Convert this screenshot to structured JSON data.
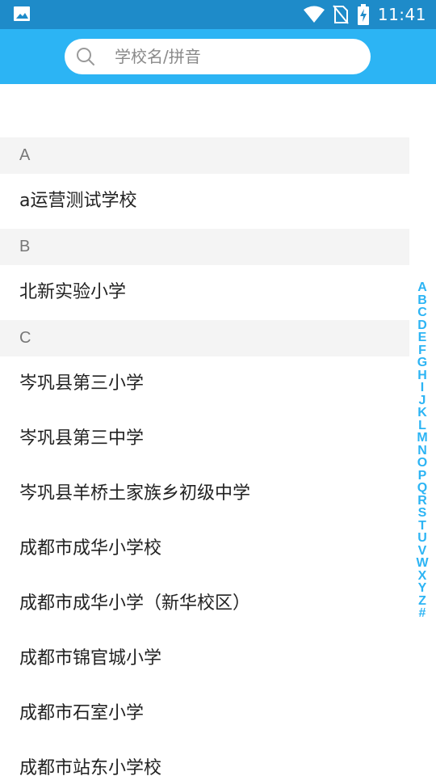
{
  "status_bar": {
    "time": "11:41",
    "icons": [
      "image-icon",
      "wifi-icon",
      "no-sim-icon",
      "battery-charging-icon"
    ]
  },
  "search": {
    "placeholder": "学校名/拼音"
  },
  "sections": [
    {
      "letter": "A",
      "items": [
        "a运营测试学校"
      ]
    },
    {
      "letter": "B",
      "items": [
        "北新实验小学"
      ]
    },
    {
      "letter": "C",
      "items": [
        "岑巩县第三小学",
        "岑巩县第三中学",
        "岑巩县羊桥土家族乡初级中学",
        "成都市成华小学校",
        "成都市成华小学（新华校区）",
        "成都市锦官城小学",
        "成都市石室小学",
        "成都市站东小学校"
      ]
    }
  ],
  "index_letters": [
    "A",
    "B",
    "C",
    "D",
    "E",
    "F",
    "G",
    "H",
    "I",
    "J",
    "K",
    "L",
    "M",
    "N",
    "O",
    "P",
    "Q",
    "R",
    "S",
    "T",
    "U",
    "V",
    "W",
    "X",
    "Y",
    "Z",
    "#"
  ],
  "colors": {
    "status_bar": "#1e8bc9",
    "header": "#2cb4f4",
    "index_letter": "#2cb4f4",
    "section_bg": "#f4f4f4"
  }
}
